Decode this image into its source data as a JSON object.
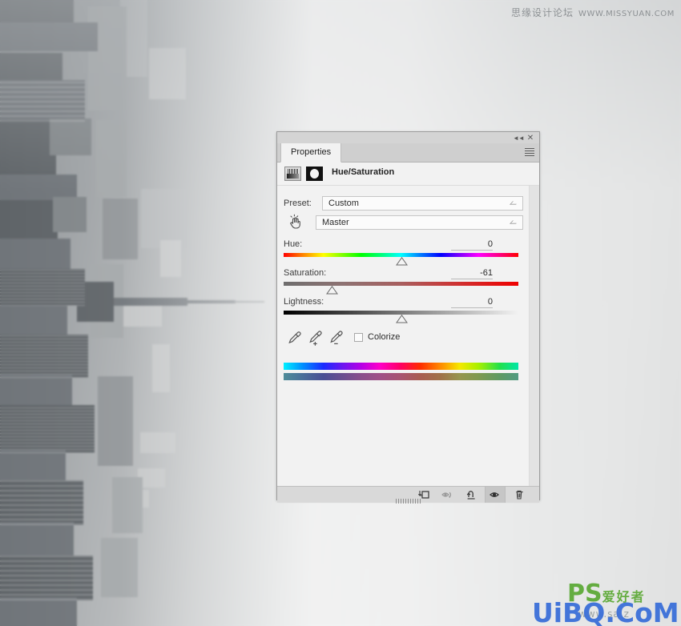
{
  "watermarks": {
    "top_cn": "思缘设计论坛",
    "top_url": "WWW.MISSYUAN.COM",
    "bottom_blue": "UiBQ.CoM",
    "bottom_green_main": "PS",
    "bottom_green_sub": "爱好者",
    "bottom_tiny": "www.sa z"
  },
  "panel": {
    "titlebar": {
      "collapse_label": "◄◄",
      "close_label": "✕"
    },
    "tabs": [
      {
        "label": "Properties",
        "active": true
      }
    ],
    "menu_icon": "hamburger-menu-icon",
    "adjustment": {
      "title": "Hue/Saturation",
      "layer_icon": "hue-saturation-adjustment-icon",
      "mask_icon": "layer-mask-thumbnail-icon"
    },
    "preset": {
      "label": "Preset:",
      "value": "Custom"
    },
    "channel": {
      "on_image_icon": "on-image-adjustment-hand-icon",
      "value": "Master"
    },
    "sliders": [
      {
        "name": "Hue:",
        "value": "0",
        "pos_pct": 50,
        "track": "hue"
      },
      {
        "name": "Saturation:",
        "value": "-61",
        "pos_pct": 20.5,
        "track": "sat"
      },
      {
        "name": "Lightness:",
        "value": "0",
        "pos_pct": 50,
        "track": "light"
      }
    ],
    "tools": {
      "dropper_sample": "eyedropper-icon",
      "dropper_add": "eyedropper-add-icon",
      "dropper_subtract": "eyedropper-subtract-icon",
      "colorize_label": "Colorize",
      "colorize_checked": false
    },
    "footer": {
      "clip_label": "clip-to-layer-icon",
      "preview_label": "view-previous-state-icon",
      "reset_label": "reset-adjustment-icon",
      "visibility_label": "toggle-layer-visibility-icon",
      "delete_label": "delete-adjustment-icon"
    }
  },
  "colors": {
    "panel_bg": "#f2f2f2",
    "panel_chrome": "#d4d4d4",
    "tab_active": "#f2f2f2",
    "watermark_blue": "#3a6fd8",
    "watermark_green": "#5aa832"
  }
}
